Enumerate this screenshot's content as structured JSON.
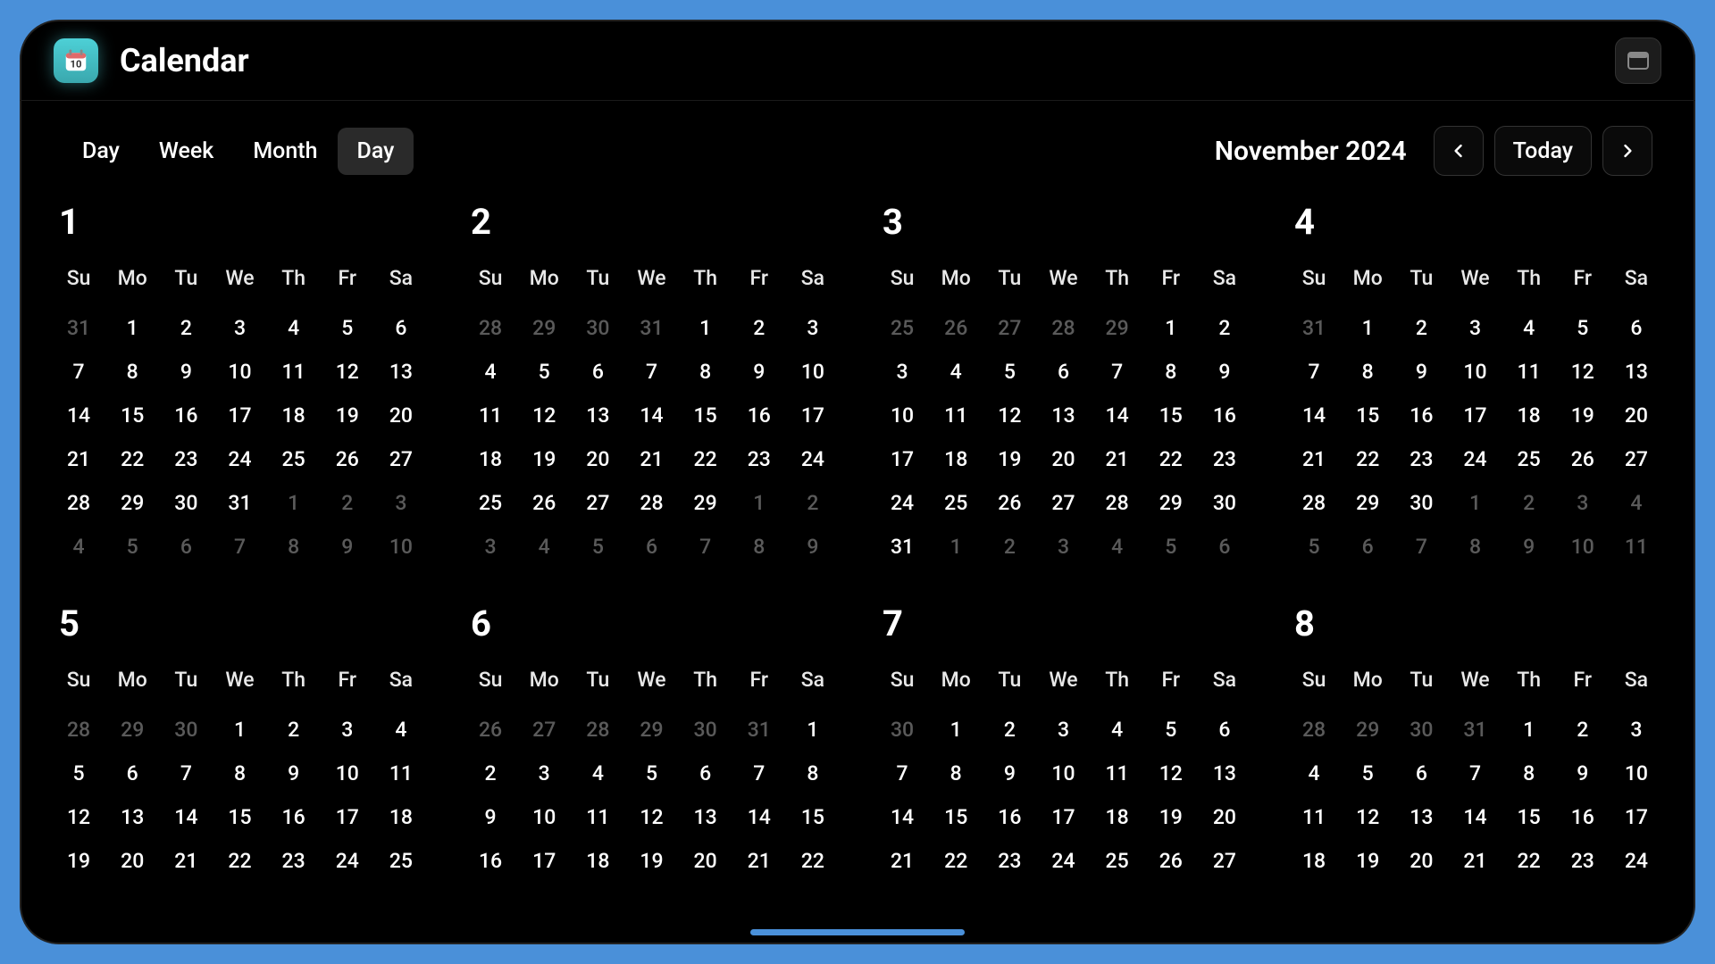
{
  "app": {
    "title": "Calendar"
  },
  "toolbar": {
    "tabs": [
      "Day",
      "Week",
      "Month",
      "Day"
    ],
    "active_tab_index": 3,
    "month_label": "November 2024",
    "today_label": "Today"
  },
  "dow": [
    "Su",
    "Mo",
    "Tu",
    "We",
    "Th",
    "Fr",
    "Sa"
  ],
  "months": [
    {
      "num": "1",
      "weeks": [
        [
          {
            "d": "31",
            "o": true
          },
          {
            "d": "1"
          },
          {
            "d": "2"
          },
          {
            "d": "3"
          },
          {
            "d": "4"
          },
          {
            "d": "5"
          },
          {
            "d": "6"
          }
        ],
        [
          {
            "d": "7"
          },
          {
            "d": "8"
          },
          {
            "d": "9"
          },
          {
            "d": "10"
          },
          {
            "d": "11"
          },
          {
            "d": "12"
          },
          {
            "d": "13"
          }
        ],
        [
          {
            "d": "14"
          },
          {
            "d": "15"
          },
          {
            "d": "16"
          },
          {
            "d": "17"
          },
          {
            "d": "18"
          },
          {
            "d": "19"
          },
          {
            "d": "20"
          }
        ],
        [
          {
            "d": "21"
          },
          {
            "d": "22"
          },
          {
            "d": "23"
          },
          {
            "d": "24"
          },
          {
            "d": "25"
          },
          {
            "d": "26"
          },
          {
            "d": "27"
          }
        ],
        [
          {
            "d": "28"
          },
          {
            "d": "29"
          },
          {
            "d": "30"
          },
          {
            "d": "31"
          },
          {
            "d": "1",
            "o": true
          },
          {
            "d": "2",
            "o": true
          },
          {
            "d": "3",
            "o": true
          }
        ],
        [
          {
            "d": "4",
            "o": true
          },
          {
            "d": "5",
            "o": true
          },
          {
            "d": "6",
            "o": true
          },
          {
            "d": "7",
            "o": true
          },
          {
            "d": "8",
            "o": true
          },
          {
            "d": "9",
            "o": true
          },
          {
            "d": "10",
            "o": true
          }
        ]
      ]
    },
    {
      "num": "2",
      "weeks": [
        [
          {
            "d": "28",
            "o": true
          },
          {
            "d": "29",
            "o": true
          },
          {
            "d": "30",
            "o": true
          },
          {
            "d": "31",
            "o": true
          },
          {
            "d": "1"
          },
          {
            "d": "2"
          },
          {
            "d": "3"
          }
        ],
        [
          {
            "d": "4"
          },
          {
            "d": "5"
          },
          {
            "d": "6"
          },
          {
            "d": "7"
          },
          {
            "d": "8"
          },
          {
            "d": "9"
          },
          {
            "d": "10"
          }
        ],
        [
          {
            "d": "11"
          },
          {
            "d": "12"
          },
          {
            "d": "13"
          },
          {
            "d": "14"
          },
          {
            "d": "15"
          },
          {
            "d": "16"
          },
          {
            "d": "17"
          }
        ],
        [
          {
            "d": "18"
          },
          {
            "d": "19"
          },
          {
            "d": "20"
          },
          {
            "d": "21"
          },
          {
            "d": "22"
          },
          {
            "d": "23"
          },
          {
            "d": "24"
          }
        ],
        [
          {
            "d": "25"
          },
          {
            "d": "26"
          },
          {
            "d": "27"
          },
          {
            "d": "28"
          },
          {
            "d": "29"
          },
          {
            "d": "1",
            "o": true
          },
          {
            "d": "2",
            "o": true
          }
        ],
        [
          {
            "d": "3",
            "o": true
          },
          {
            "d": "4",
            "o": true
          },
          {
            "d": "5",
            "o": true
          },
          {
            "d": "6",
            "o": true
          },
          {
            "d": "7",
            "o": true
          },
          {
            "d": "8",
            "o": true
          },
          {
            "d": "9",
            "o": true
          }
        ]
      ]
    },
    {
      "num": "3",
      "weeks": [
        [
          {
            "d": "25",
            "o": true
          },
          {
            "d": "26",
            "o": true
          },
          {
            "d": "27",
            "o": true
          },
          {
            "d": "28",
            "o": true
          },
          {
            "d": "29",
            "o": true
          },
          {
            "d": "1"
          },
          {
            "d": "2"
          }
        ],
        [
          {
            "d": "3"
          },
          {
            "d": "4"
          },
          {
            "d": "5"
          },
          {
            "d": "6"
          },
          {
            "d": "7"
          },
          {
            "d": "8"
          },
          {
            "d": "9"
          }
        ],
        [
          {
            "d": "10"
          },
          {
            "d": "11"
          },
          {
            "d": "12"
          },
          {
            "d": "13"
          },
          {
            "d": "14"
          },
          {
            "d": "15"
          },
          {
            "d": "16"
          }
        ],
        [
          {
            "d": "17"
          },
          {
            "d": "18"
          },
          {
            "d": "19"
          },
          {
            "d": "20"
          },
          {
            "d": "21"
          },
          {
            "d": "22"
          },
          {
            "d": "23"
          }
        ],
        [
          {
            "d": "24"
          },
          {
            "d": "25"
          },
          {
            "d": "26"
          },
          {
            "d": "27"
          },
          {
            "d": "28"
          },
          {
            "d": "29"
          },
          {
            "d": "30"
          }
        ],
        [
          {
            "d": "31"
          },
          {
            "d": "1",
            "o": true
          },
          {
            "d": "2",
            "o": true
          },
          {
            "d": "3",
            "o": true
          },
          {
            "d": "4",
            "o": true
          },
          {
            "d": "5",
            "o": true
          },
          {
            "d": "6",
            "o": true
          }
        ]
      ]
    },
    {
      "num": "4",
      "weeks": [
        [
          {
            "d": "31",
            "o": true
          },
          {
            "d": "1"
          },
          {
            "d": "2"
          },
          {
            "d": "3"
          },
          {
            "d": "4"
          },
          {
            "d": "5"
          },
          {
            "d": "6"
          }
        ],
        [
          {
            "d": "7"
          },
          {
            "d": "8"
          },
          {
            "d": "9"
          },
          {
            "d": "10"
          },
          {
            "d": "11"
          },
          {
            "d": "12"
          },
          {
            "d": "13"
          }
        ],
        [
          {
            "d": "14"
          },
          {
            "d": "15"
          },
          {
            "d": "16"
          },
          {
            "d": "17"
          },
          {
            "d": "18"
          },
          {
            "d": "19"
          },
          {
            "d": "20"
          }
        ],
        [
          {
            "d": "21"
          },
          {
            "d": "22"
          },
          {
            "d": "23"
          },
          {
            "d": "24"
          },
          {
            "d": "25"
          },
          {
            "d": "26"
          },
          {
            "d": "27"
          }
        ],
        [
          {
            "d": "28"
          },
          {
            "d": "29"
          },
          {
            "d": "30"
          },
          {
            "d": "1",
            "o": true
          },
          {
            "d": "2",
            "o": true
          },
          {
            "d": "3",
            "o": true
          },
          {
            "d": "4",
            "o": true
          }
        ],
        [
          {
            "d": "5",
            "o": true
          },
          {
            "d": "6",
            "o": true
          },
          {
            "d": "7",
            "o": true
          },
          {
            "d": "8",
            "o": true
          },
          {
            "d": "9",
            "o": true
          },
          {
            "d": "10",
            "o": true
          },
          {
            "d": "11",
            "o": true
          }
        ]
      ]
    },
    {
      "num": "5",
      "weeks": [
        [
          {
            "d": "28",
            "o": true
          },
          {
            "d": "29",
            "o": true
          },
          {
            "d": "30",
            "o": true
          },
          {
            "d": "1"
          },
          {
            "d": "2"
          },
          {
            "d": "3"
          },
          {
            "d": "4"
          }
        ],
        [
          {
            "d": "5"
          },
          {
            "d": "6"
          },
          {
            "d": "7"
          },
          {
            "d": "8"
          },
          {
            "d": "9"
          },
          {
            "d": "10"
          },
          {
            "d": "11"
          }
        ],
        [
          {
            "d": "12"
          },
          {
            "d": "13"
          },
          {
            "d": "14"
          },
          {
            "d": "15"
          },
          {
            "d": "16"
          },
          {
            "d": "17"
          },
          {
            "d": "18"
          }
        ],
        [
          {
            "d": "19"
          },
          {
            "d": "20"
          },
          {
            "d": "21"
          },
          {
            "d": "22"
          },
          {
            "d": "23"
          },
          {
            "d": "24"
          },
          {
            "d": "25"
          }
        ]
      ]
    },
    {
      "num": "6",
      "weeks": [
        [
          {
            "d": "26",
            "o": true
          },
          {
            "d": "27",
            "o": true
          },
          {
            "d": "28",
            "o": true
          },
          {
            "d": "29",
            "o": true
          },
          {
            "d": "30",
            "o": true
          },
          {
            "d": "31",
            "o": true
          },
          {
            "d": "1"
          }
        ],
        [
          {
            "d": "2"
          },
          {
            "d": "3"
          },
          {
            "d": "4"
          },
          {
            "d": "5"
          },
          {
            "d": "6"
          },
          {
            "d": "7"
          },
          {
            "d": "8"
          }
        ],
        [
          {
            "d": "9"
          },
          {
            "d": "10"
          },
          {
            "d": "11"
          },
          {
            "d": "12"
          },
          {
            "d": "13"
          },
          {
            "d": "14"
          },
          {
            "d": "15"
          }
        ],
        [
          {
            "d": "16"
          },
          {
            "d": "17"
          },
          {
            "d": "18"
          },
          {
            "d": "19"
          },
          {
            "d": "20"
          },
          {
            "d": "21"
          },
          {
            "d": "22"
          }
        ]
      ]
    },
    {
      "num": "7",
      "weeks": [
        [
          {
            "d": "30",
            "o": true
          },
          {
            "d": "1"
          },
          {
            "d": "2"
          },
          {
            "d": "3"
          },
          {
            "d": "4"
          },
          {
            "d": "5"
          },
          {
            "d": "6"
          }
        ],
        [
          {
            "d": "7"
          },
          {
            "d": "8"
          },
          {
            "d": "9"
          },
          {
            "d": "10"
          },
          {
            "d": "11"
          },
          {
            "d": "12"
          },
          {
            "d": "13"
          }
        ],
        [
          {
            "d": "14"
          },
          {
            "d": "15"
          },
          {
            "d": "16"
          },
          {
            "d": "17"
          },
          {
            "d": "18"
          },
          {
            "d": "19"
          },
          {
            "d": "20"
          }
        ],
        [
          {
            "d": "21"
          },
          {
            "d": "22"
          },
          {
            "d": "23"
          },
          {
            "d": "24"
          },
          {
            "d": "25"
          },
          {
            "d": "26"
          },
          {
            "d": "27"
          }
        ]
      ]
    },
    {
      "num": "8",
      "weeks": [
        [
          {
            "d": "28",
            "o": true
          },
          {
            "d": "29",
            "o": true
          },
          {
            "d": "30",
            "o": true
          },
          {
            "d": "31",
            "o": true
          },
          {
            "d": "1"
          },
          {
            "d": "2"
          },
          {
            "d": "3"
          }
        ],
        [
          {
            "d": "4"
          },
          {
            "d": "5"
          },
          {
            "d": "6"
          },
          {
            "d": "7"
          },
          {
            "d": "8"
          },
          {
            "d": "9"
          },
          {
            "d": "10"
          }
        ],
        [
          {
            "d": "11"
          },
          {
            "d": "12"
          },
          {
            "d": "13"
          },
          {
            "d": "14"
          },
          {
            "d": "15"
          },
          {
            "d": "16"
          },
          {
            "d": "17"
          }
        ],
        [
          {
            "d": "18"
          },
          {
            "d": "19"
          },
          {
            "d": "20"
          },
          {
            "d": "21"
          },
          {
            "d": "22"
          },
          {
            "d": "23"
          },
          {
            "d": "24"
          }
        ]
      ]
    }
  ]
}
